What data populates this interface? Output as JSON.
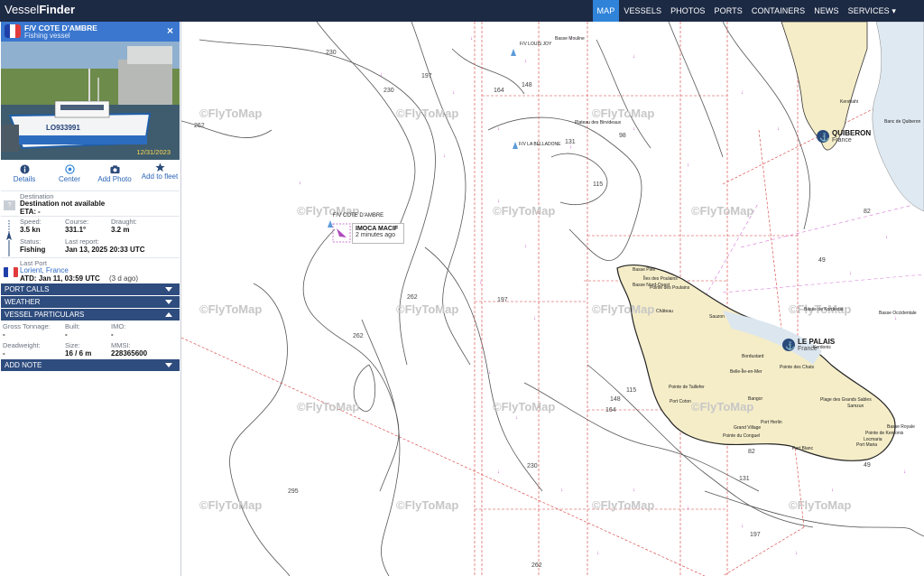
{
  "app": {
    "logo_a": "Vessel",
    "logo_b": "Finder"
  },
  "nav": [
    {
      "label": "MAP",
      "active": true
    },
    {
      "label": "VESSELS"
    },
    {
      "label": "PHOTOS"
    },
    {
      "label": "PORTS"
    },
    {
      "label": "CONTAINERS"
    },
    {
      "label": "NEWS"
    },
    {
      "label": "SERVICES ▾"
    }
  ],
  "vessel": {
    "name": "F/V COTE D'AMBRE",
    "type": "Fishing vessel",
    "photo_date": "12/31/2023",
    "hull_text": "LO933991",
    "close": "×"
  },
  "actions": [
    {
      "label": "Details",
      "icon": "info-icon"
    },
    {
      "label": "Center",
      "icon": "target-icon"
    },
    {
      "label": "Add Photo",
      "icon": "camera-icon"
    },
    {
      "label": "Add to fleet",
      "icon": "star-icon"
    }
  ],
  "destination": {
    "label": "Destination",
    "value": "Destination not available",
    "eta_label": "ETA:",
    "eta_value": "-",
    "unknown_flag": "?"
  },
  "voyage": {
    "speed_label": "Speed:",
    "speed": "3.5 kn",
    "course_label": "Course:",
    "course": "331.1°",
    "draught_label": "Draught:",
    "draught": "3.2 m",
    "status_label": "Status:",
    "status": "Fishing",
    "report_label": "Last report:",
    "report": "Jan 13, 2025 20:33 UTC"
  },
  "last_port": {
    "label": "Last Port",
    "port": "Lorient, France",
    "atd": "ATD: Jan 11, 03:59 UTC",
    "ago": "(3 d ago)"
  },
  "sections": {
    "port_calls": "PORT CALLS",
    "weather": "WEATHER",
    "particulars": "VESSEL PARTICULARS",
    "add_note": "ADD NOTE"
  },
  "particulars": {
    "gt_label": "Gross Tonnage:",
    "gt": "-",
    "built_label": "Built:",
    "built": "-",
    "imo_label": "IMO:",
    "imo": "-",
    "dwt_label": "Deadweight:",
    "dwt": "-",
    "size_label": "Size:",
    "size": "16 / 6 m",
    "mmsi_label": "MMSI:",
    "mmsi": "228365600"
  },
  "map": {
    "watermark": "©FlyToMap",
    "vessel_label": "F/V COTE D'AMBRE",
    "popup_title": "IMOCA MACIF",
    "popup_time": "2 minutes ago",
    "port1_name": "QUIBERON",
    "port1_country": "France",
    "port2_name": "LE PALAIS",
    "port2_country": "France",
    "depths": [
      "230",
      "197",
      "262",
      "230",
      "164",
      "148",
      "131",
      "115",
      "98",
      "197",
      "262",
      "262",
      "230",
      "295",
      "148",
      "115",
      "164",
      "131",
      "197",
      "262",
      "49",
      "49",
      "82",
      "82"
    ],
    "places": [
      "Basse Mouline",
      "F/V LOUIS JOY",
      "Plateau des Birvideaux",
      "F/V LA BELLADONE",
      "Basse Piée",
      "Belle-Île-en-Mer",
      "Îles des Poulains",
      "Pointe des Poulains",
      "Sauzon",
      "Bordustard",
      "Bangor",
      "Kerdonis",
      "Port Coton",
      "Plage des Grands Sables",
      "Basse Occidentale",
      "Pointe de Kerdonis",
      "Basse de Kordestat",
      "Pointe de Taillefer",
      "Grand Village",
      "Port Herlin",
      "Basse Royale",
      "Basse Nord-Ouest",
      "Locmaria",
      "Port Maria",
      "Pointe du Conguel",
      "Banc de Quiberon",
      "Château",
      "Samzun",
      "Port Blanc",
      "Kerstrahi",
      "Pointe des Chats"
    ]
  }
}
